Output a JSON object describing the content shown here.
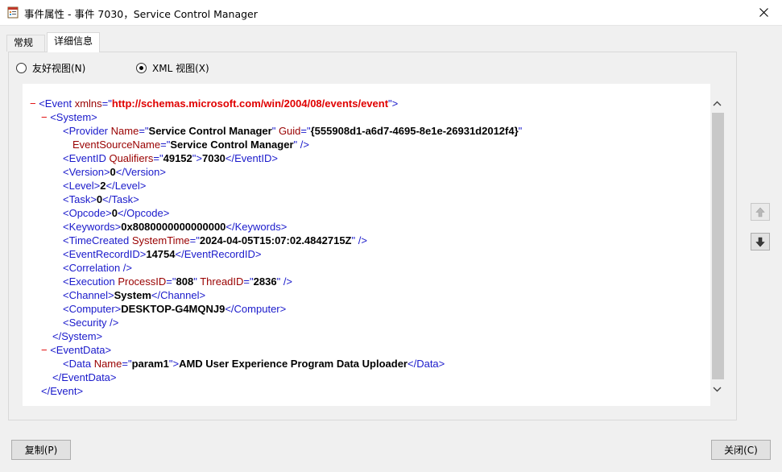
{
  "window": {
    "title": "事件属性 - 事件 7030，Service Control Manager",
    "close_glyph": "✕"
  },
  "tabs": [
    {
      "label": "常规",
      "active": false
    },
    {
      "label": "详细信息",
      "active": true
    }
  ],
  "view_options": {
    "friendly": {
      "label": "友好视图(N)",
      "selected": false
    },
    "xml": {
      "label": "XML 视图(X)",
      "selected": true
    }
  },
  "xml": {
    "event_ns_value": "http://schemas.microsoft.com/win/2004/08/events/event",
    "provider_name": "Service Control Manager",
    "provider_guid": "{555908d1-a6d7-4695-8e1e-26931d2012f4}",
    "event_source_name": "Service Control Manager",
    "qualifiers": "49152",
    "event_id": "7030",
    "version": "0",
    "level": "2",
    "task": "0",
    "opcode": "0",
    "keywords": "0x8080000000000000",
    "system_time": "2024-04-05T15:07:02.4842715Z",
    "event_record_id": "14754",
    "process_id": "808",
    "thread_id": "2836",
    "channel": "System",
    "computer": "DESKTOP-G4MQNJ9",
    "data_name": "param1",
    "data_value": "AMD User Experience Program Data Uploader"
  },
  "buttons": {
    "copy": "复制(P)",
    "close": "关闭(C)"
  },
  "colors": {
    "tag": "#1a1acb",
    "attr_name": "#990000",
    "collapse": "#e00000"
  }
}
